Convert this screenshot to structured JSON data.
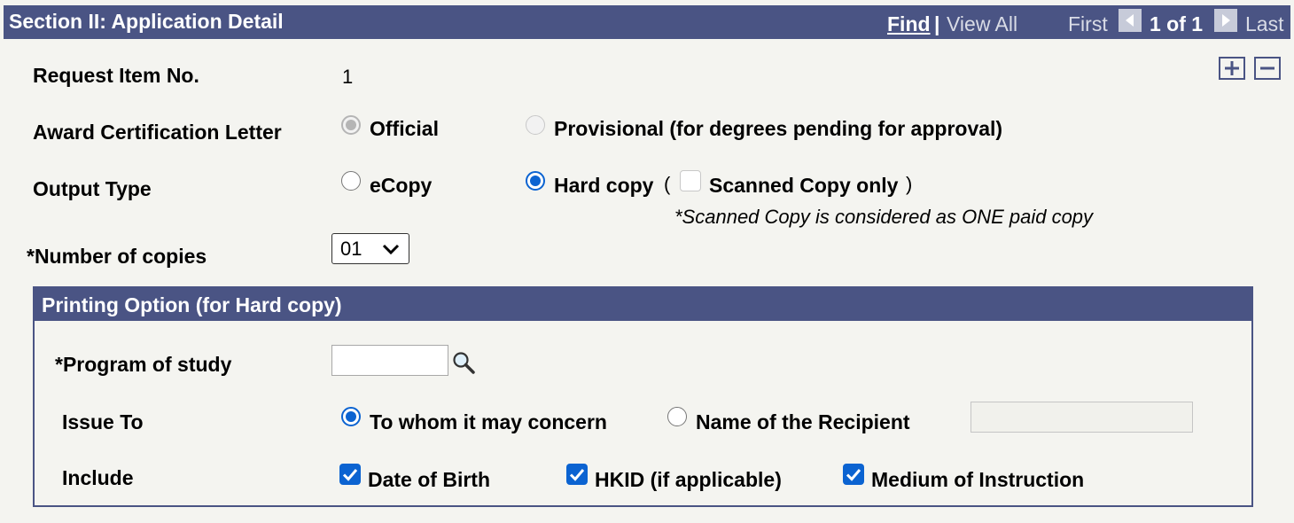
{
  "section": {
    "title": "Section II: Application Detail",
    "nav": {
      "find": "Find",
      "separator": "|",
      "view_all": "View All",
      "first": "First",
      "count": "1 of 1",
      "last": "Last"
    }
  },
  "request_item": {
    "label": "Request Item No.",
    "value": "1"
  },
  "award_letter": {
    "label": "Award Certification Letter",
    "options": [
      {
        "label": "Official",
        "selected": true,
        "disabled": true
      },
      {
        "label": "Provisional (for degrees pending for approval)",
        "selected": false,
        "disabled": true
      }
    ]
  },
  "output_type": {
    "label": "Output Type",
    "options": [
      {
        "label": "eCopy",
        "selected": false
      },
      {
        "label": "Hard copy",
        "selected": true
      }
    ],
    "paren_open": "(",
    "scanned_label": "Scanned Copy only",
    "scanned_checked": false,
    "paren_close": ")",
    "note": "*Scanned Copy is considered as ONE paid copy"
  },
  "copies": {
    "label": "*Number of copies",
    "value": "01"
  },
  "printing": {
    "title": "Printing Option (for Hard copy)",
    "program_label": "*Program of study",
    "program_value": "",
    "issue_to": {
      "label": "Issue To",
      "options": [
        {
          "label": "To whom it may concern",
          "selected": true
        },
        {
          "label": "Name of the Recipient",
          "selected": false
        }
      ],
      "recipient_value": ""
    },
    "include": {
      "label": "Include",
      "items": [
        {
          "label": "Date of Birth",
          "checked": true
        },
        {
          "label": "HKID (if applicable)",
          "checked": true
        },
        {
          "label": "Medium of Instruction",
          "checked": true
        }
      ]
    }
  },
  "colors": {
    "header": "#4a5484",
    "accent": "#0b63d1",
    "background": "#f4f4f0"
  },
  "icons": [
    "nav-first-arrow-icon",
    "nav-next-arrow-icon",
    "add-row-icon",
    "delete-row-icon",
    "lookup-search-icon",
    "checkmark-icon",
    "dropdown-chevron-icon"
  ]
}
